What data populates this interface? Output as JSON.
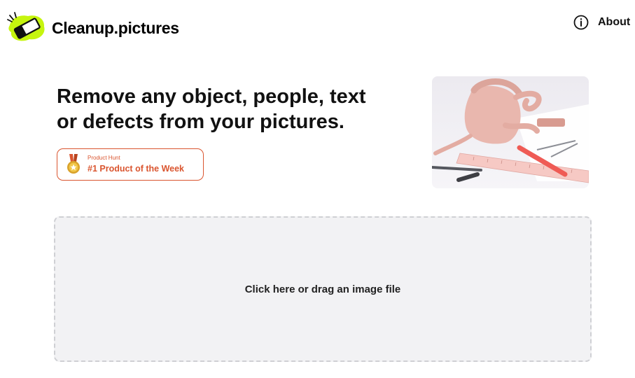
{
  "header": {
    "brand_name": "Cleanup.pictures",
    "logo_icon": "eraser-logo-icon",
    "about_label": "About",
    "about_icon": "info-circle-icon"
  },
  "hero": {
    "title_line1": "Remove any object, people, text",
    "title_line2": "or defects from your pictures.",
    "badge": {
      "small_label": "Product Hunt",
      "main_label": "#1 Product of the Week",
      "icon": "medal-icon",
      "color": "#da552f"
    },
    "image_icon": "product-photo-illustration"
  },
  "dropzone": {
    "label": "Click here or drag an image file"
  },
  "colors": {
    "accent_green": "#c6f50e",
    "badge_orange": "#da552f",
    "dropzone_bg": "#f2f2f4",
    "dropzone_border": "#cfd0d4"
  }
}
